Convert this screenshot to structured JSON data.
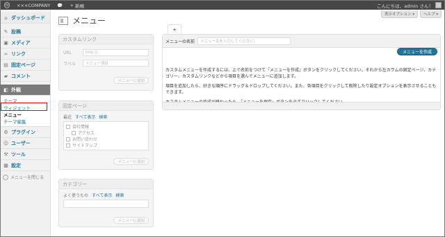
{
  "adminbar": {
    "site_name": "×××COMPANY",
    "comments_icon": "comment-bubble-icon",
    "new_label": "新規",
    "greeting": "こんにちは、admin さん！"
  },
  "screen_meta": {
    "options": "表示オプション ▾",
    "help": "ヘルプ ▾"
  },
  "sidebar": {
    "dashboard": "ダッシュボード",
    "posts": "投稿",
    "media": "メディア",
    "links": "リンク",
    "pages": "固定ページ",
    "comments": "コメント",
    "appearance": "外観",
    "appearance_sub": [
      "テーマ",
      "ウィジェット",
      "メニュー",
      "テーマ編集"
    ],
    "plugins": "プラグイン",
    "users": "ユーザー",
    "tools": "ツール",
    "settings": "設定",
    "collapse": "メニューを閉じる"
  },
  "page": {
    "title": "メニュー"
  },
  "custom_link": {
    "title": "カスタムリンク",
    "url_label": "URL",
    "url_value": "http://",
    "label_label": "ラベル",
    "label_placeholder": "メニュー項目",
    "add_button": "メニューに追加"
  },
  "pages_box": {
    "title": "固定ページ",
    "tabs": [
      "最近",
      "すべて表示",
      "検索"
    ],
    "items": [
      "会社情報",
      "アクセス",
      "お問い合わせ",
      "サイトマップ"
    ],
    "add_button": "メニューに追加"
  },
  "categories_box": {
    "title": "カテゴリー",
    "tabs": [
      "よく使うもの",
      "すべて表示",
      "検索"
    ],
    "add_button": "メニューに追加"
  },
  "menu_editor": {
    "tab_label": "+",
    "name_label": "メニューの名前",
    "name_placeholder": "メニュー名を入力してください。",
    "create_button": "メニューを作成",
    "instructions": [
      "カスタムメニューを作成するには、上で名前をつけて「メニューを作成」ボタンをクリックしてください。それから左カラムの固定ページ、カテゴリー、カスタムリンクなどから項目を選んでメニューに追加します。",
      "項目を追加したら、好きな順序にドラッグ＆ドロップしてください。また、各項目をクリックして削除したり設定オプションを表示させることもできます。",
      "カスタムメニューの作成が終わったら、「メニューを保存」ボタンを必ずクリックしてください。"
    ]
  }
}
